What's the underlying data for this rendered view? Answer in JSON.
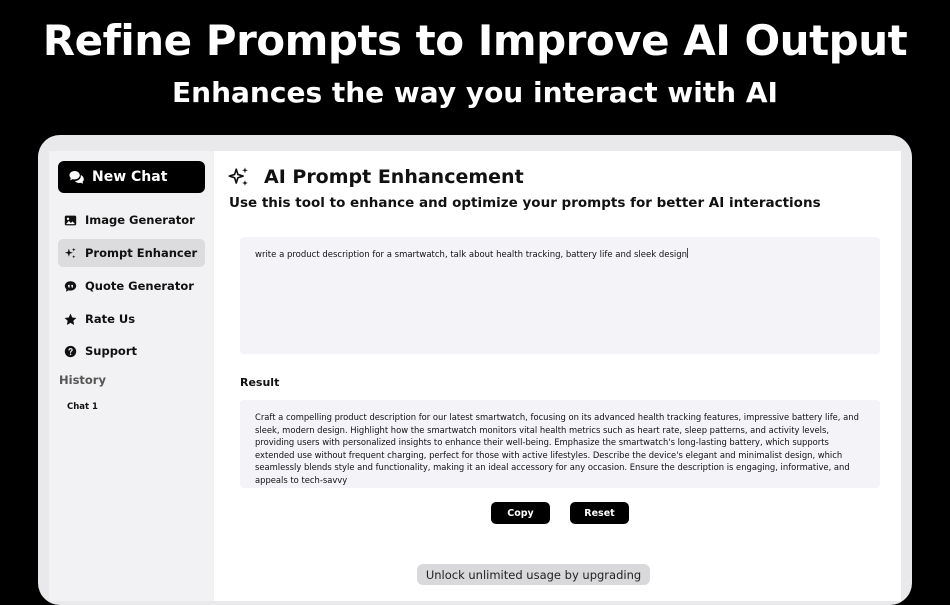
{
  "hero": {
    "title": "Refine Prompts to Improve AI Output",
    "subtitle": "Enhances the way you interact with AI"
  },
  "sidebar": {
    "new_chat_label": "New Chat",
    "items": [
      {
        "label": "Image Generator",
        "icon": "image-icon",
        "active": false
      },
      {
        "label": "Prompt Enhancer",
        "icon": "sparkles-icon",
        "active": true
      },
      {
        "label": "Quote Generator",
        "icon": "quote-bubble-icon",
        "active": false
      },
      {
        "label": "Rate Us",
        "icon": "star-icon",
        "active": false
      },
      {
        "label": "Support",
        "icon": "help-circle-icon",
        "active": false
      }
    ],
    "history_label": "History",
    "history_items": [
      "Chat 1"
    ]
  },
  "main": {
    "title": "AI Prompt Enhancement",
    "description": "Use this tool to enhance and optimize your prompts for better AI interactions",
    "prompt_value": "write a product description for a smartwatch, talk about health tracking, battery life and sleek design",
    "result_label": "Result",
    "result_text": "Craft a compelling product description for our latest smartwatch, focusing on its advanced health tracking features, impressive battery life, and sleek, modern design. Highlight how the smartwatch monitors vital health metrics such as heart rate, sleep patterns, and activity levels, providing users with personalized insights to enhance their well-being. Emphasize the smartwatch's long-lasting battery, which supports extended use without frequent charging, perfect for those with active lifestyles. Describe the device's elegant and minimalist design, which seamlessly blends style and functionality, making it an ideal accessory for any occasion. Ensure the description is engaging, informative, and appeals to tech-savvy",
    "copy_label": "Copy",
    "reset_label": "Reset",
    "upgrade_label": "Unlock unlimited usage by upgrading"
  },
  "colors": {
    "background": "#000000",
    "accent": "#000000",
    "panel": "#f4f4f8",
    "sidebar": "#f2f2f4",
    "caret": "#1a3cff"
  }
}
